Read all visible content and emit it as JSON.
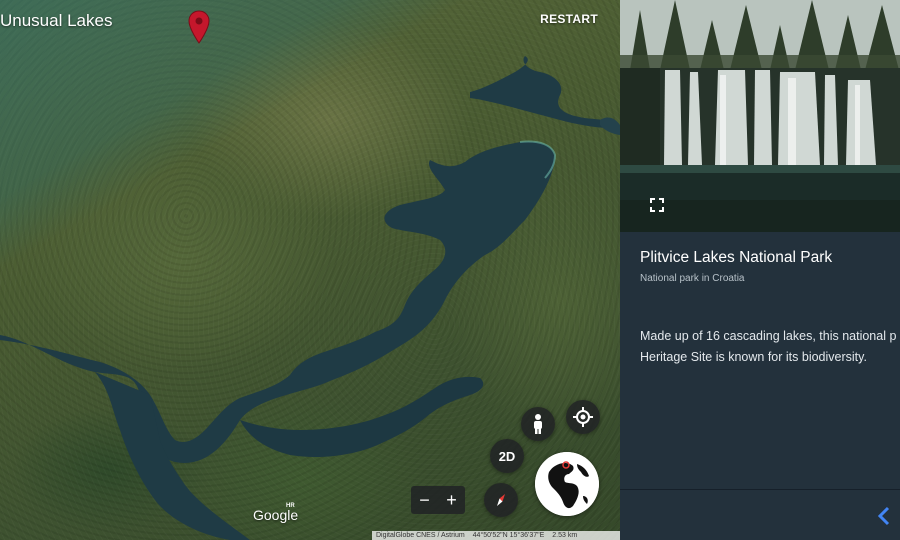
{
  "app": {
    "title": "Unusual Lakes",
    "restart_label": "RESTART"
  },
  "map": {
    "controls": {
      "pegman_icon": "person-icon",
      "locate_icon": "my-location-icon",
      "mode_label": "2D",
      "compass_icon": "compass-icon",
      "zoom_out_label": "−",
      "zoom_in_label": "+",
      "globe_icon": "globe-icon"
    },
    "logo_text": "Google",
    "logo_region": "HR",
    "attribution": {
      "providers": "DigitalGlobe  CNES / Astrium",
      "coordinates": "44°50'52\"N 15°36'37\"E",
      "scale": "2.53 km"
    },
    "pin_color": "#c5172c",
    "water_color": "#1f3b45"
  },
  "panel": {
    "fullscreen_icon": "fullscreen-icon",
    "title": "Plitvice Lakes National Park",
    "subtitle": "National park in Croatia",
    "description_lines": [
      "Made up of 16 cascading lakes, this national p",
      "Heritage Site is known for its biodiversity."
    ],
    "back_icon": "chevron-left-icon",
    "accent_color": "#4285f4"
  }
}
